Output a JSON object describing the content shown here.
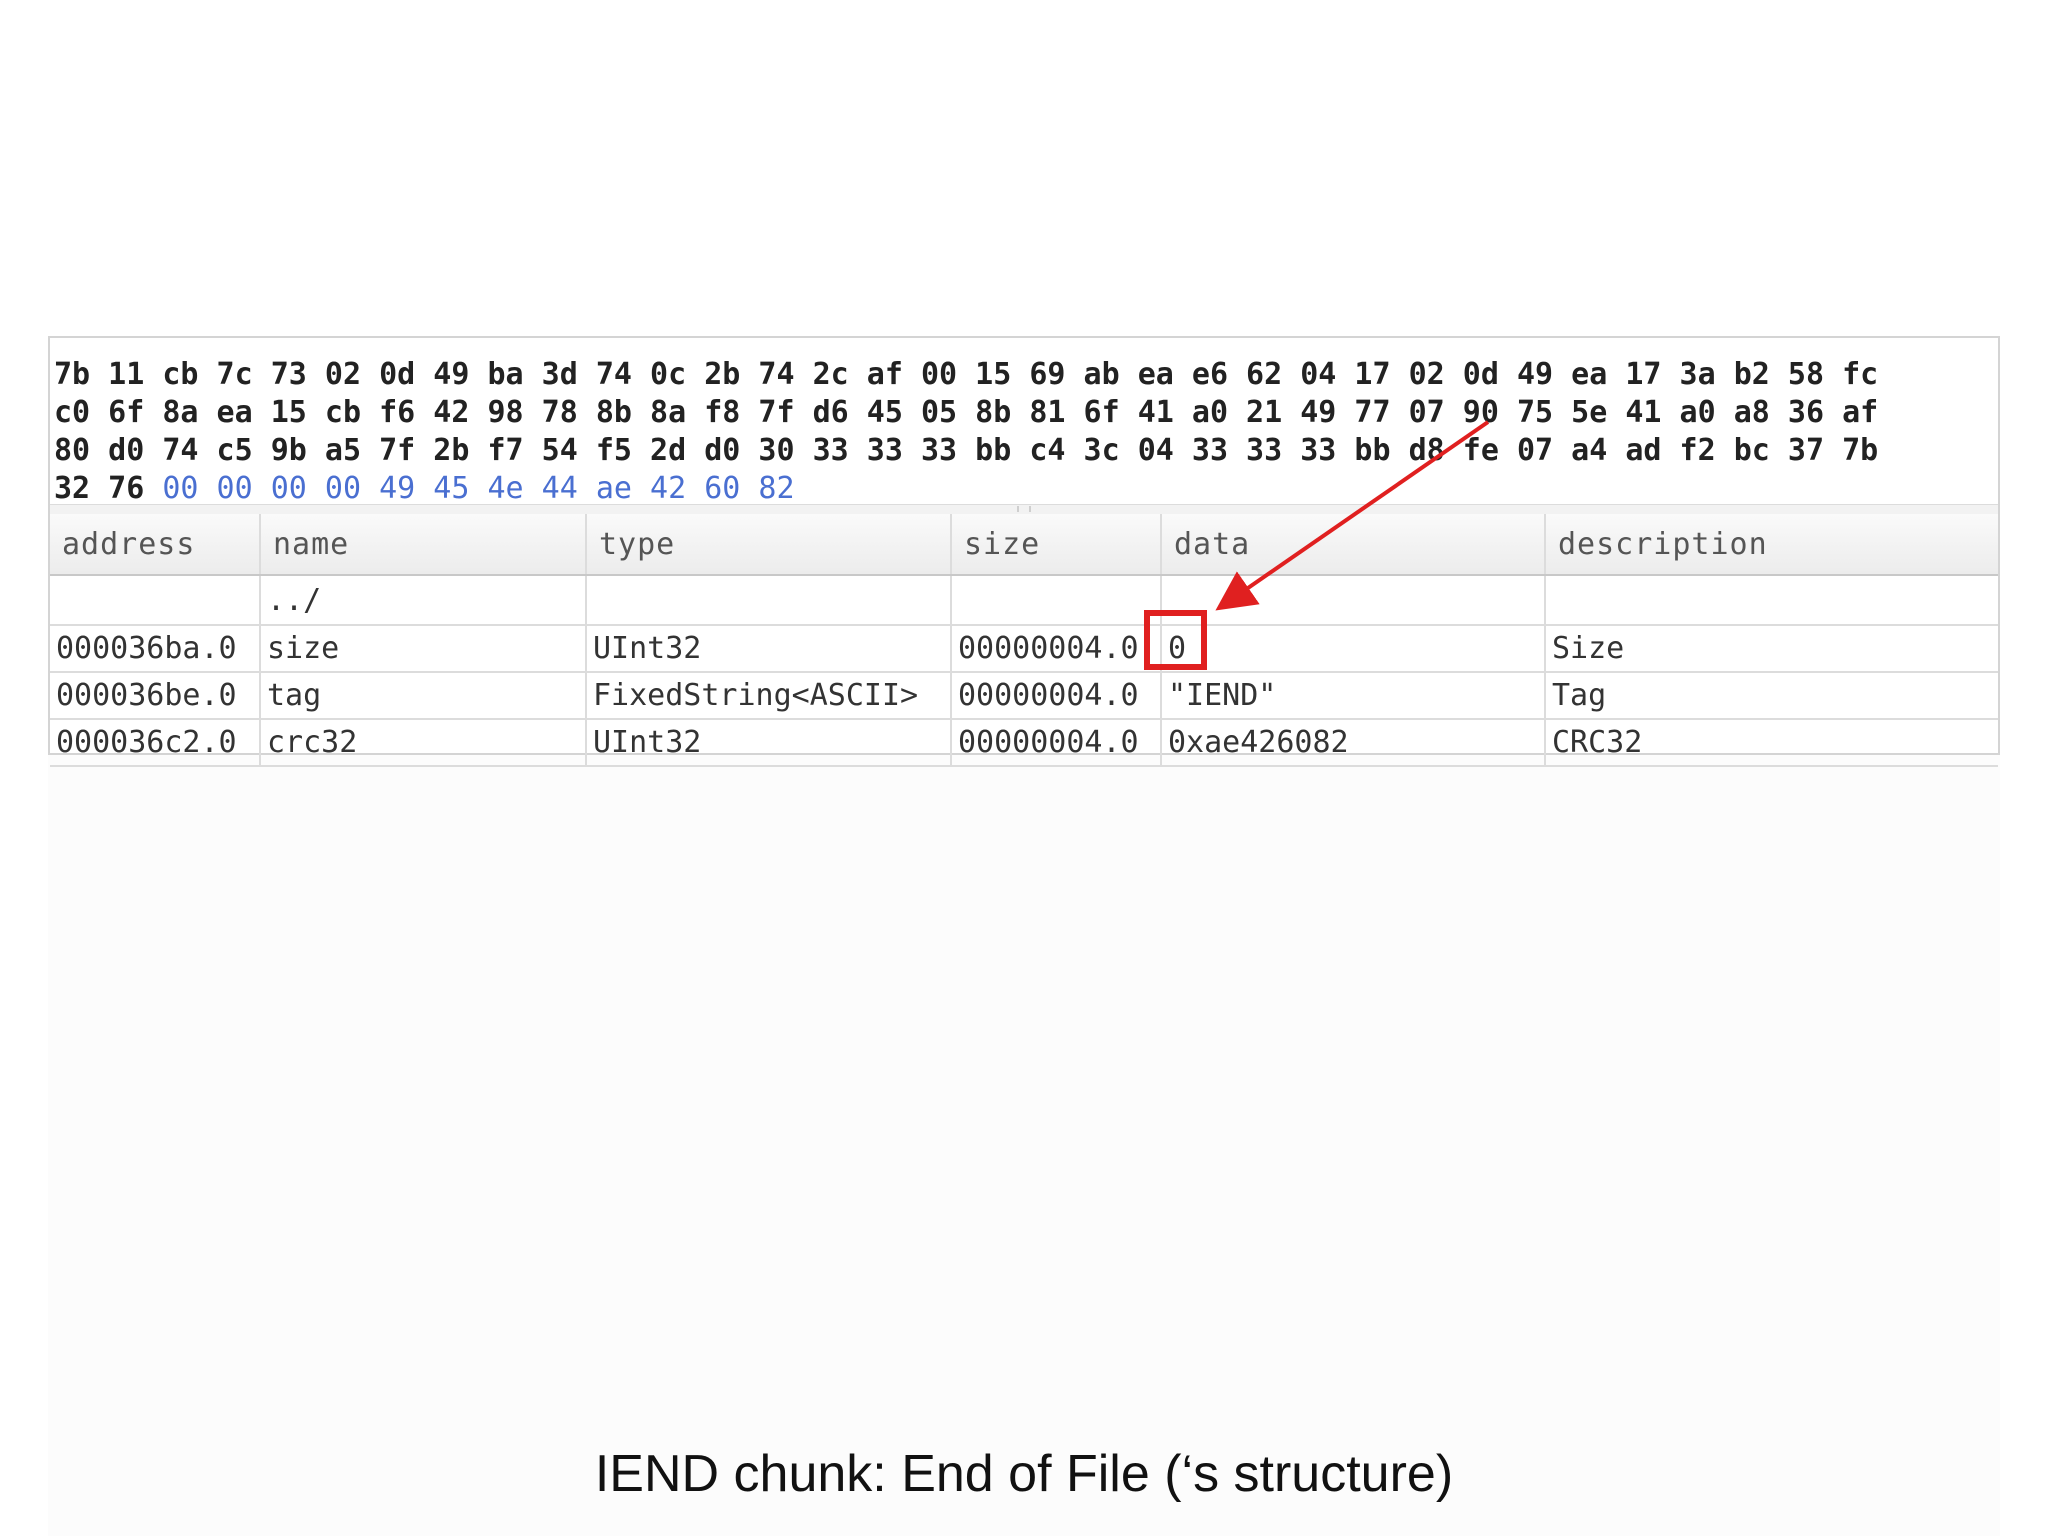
{
  "hex_view": {
    "lines": [
      "7b 11 cb 7c 73 02 0d 49 ba 3d 74 0c 2b 74 2c af 00 15 69 ab ea e6 62 04 17 02 0d 49 ea 17 3a b2 58 fc",
      "c0 6f 8a ea 15 cb f6 42 98 78 8b 8a f8 7f d6 45 05 8b 81 6f 41 a0 21 49 77 07 90 75 5e 41 a0 a8 36 af",
      "80 d0 74 c5 9b a5 7f 2b f7 54 f5 2d d0 30 33 33 33 bb c4 3c 04 33 33 33 bb d8 fe 07 a4 ad f2 bc 37 7b"
    ],
    "last_line_plain": "32 76 ",
    "last_line_highlighted": "00 00 00 00 49 45 4e 44 ae 42 60 82",
    "highlight_color": "#4a6fd1"
  },
  "table": {
    "headers": {
      "address": "address",
      "name": "name",
      "type": "type",
      "size": "size",
      "data": "data",
      "description": "description"
    },
    "parent_row": {
      "name": "../"
    },
    "rows": [
      {
        "address": "000036ba.0",
        "name": "size",
        "type": "UInt32",
        "size": "00000004.0",
        "data": "0",
        "description": "Size"
      },
      {
        "address": "000036be.0",
        "name": "tag",
        "type": "FixedString<ASCII>",
        "size": "00000004.0",
        "data": "\"IEND\"",
        "description": "Tag"
      },
      {
        "address": "000036c2.0",
        "name": "crc32",
        "type": "UInt32",
        "size": "00000004.0",
        "data": "0xae426082",
        "description": "CRC32"
      }
    ]
  },
  "annotation": {
    "color": "#e02020",
    "highlighted_cell": "size-row-data"
  },
  "caption": "IEND chunk: End of File (‘s structure)"
}
